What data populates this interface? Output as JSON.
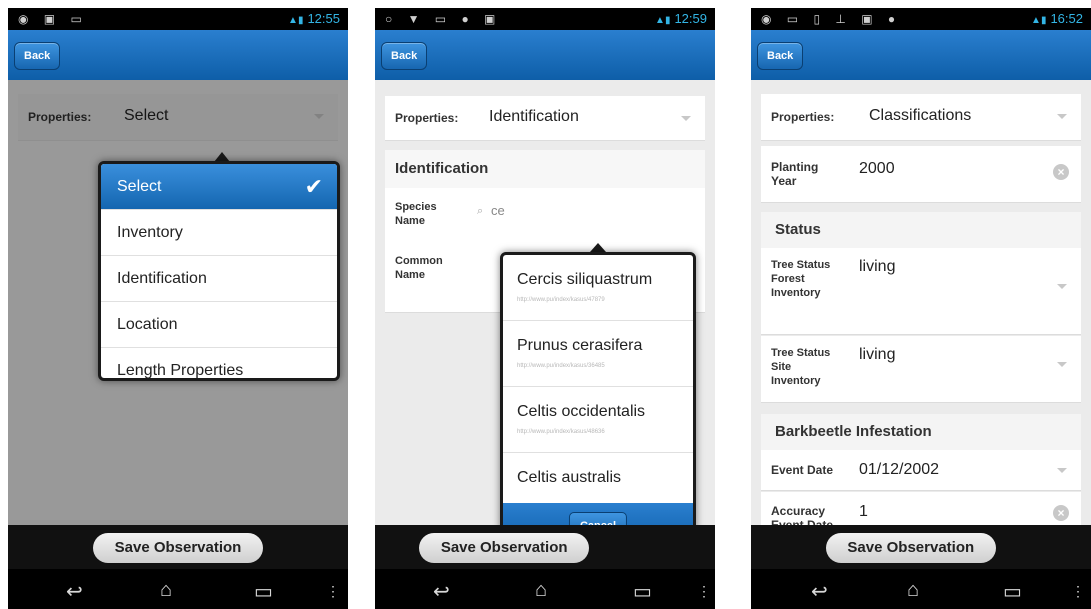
{
  "shared": {
    "back_label": "Back",
    "save_label": "Save Observation",
    "properties_label": "Properties:",
    "nav": {
      "back_icon": "back-arrow-icon",
      "home_icon": "home-icon",
      "recents_icon": "recents-icon",
      "menu_icon": "overflow-menu-icon"
    }
  },
  "screen1": {
    "time": "12:55",
    "properties_value": "Select",
    "dropdown": {
      "items": [
        "Select",
        "Inventory",
        "Identification",
        "Location",
        "Length Properties"
      ],
      "selected_index": 0
    }
  },
  "screen2": {
    "time": "12:59",
    "properties_value": "Identification",
    "section_title": "Identification",
    "species_label": "Species Name",
    "species_input": "ce",
    "common_label": "Common Name",
    "suggestions": [
      {
        "name": "Cercis siliquastrum",
        "url": "http://www.pu/index/kasus/47879"
      },
      {
        "name": "Prunus cerasifera",
        "url": "http://www.pu/index/kasus/36485"
      },
      {
        "name": "Celtis occidentalis",
        "url": "http://www.pu/index/kasus/48636"
      },
      {
        "name": "Celtis australis",
        "url": ""
      }
    ],
    "cancel_label": "Cancel"
  },
  "screen3": {
    "time": "16:52",
    "properties_value": "Classifications",
    "planting_label": "Planting Year",
    "planting_value": "2000",
    "status_section": "Status",
    "tree_status_forest_label": "Tree Status Forest Inventory",
    "tree_status_forest_value": "living",
    "tree_status_site_label": "Tree Status Site Inventory",
    "tree_status_site_value": "living",
    "barkbeetle_section": "Barkbeetle Infestation",
    "event_date_label": "Event Date",
    "event_date_value": "01/12/2002",
    "accuracy_label": "Accuracy Event Date",
    "accuracy_value": "1"
  },
  "colors": {
    "header_blue": "#1b6fbf",
    "selected_blue": "#2a7fd0",
    "status_blue": "#33b5e5"
  }
}
